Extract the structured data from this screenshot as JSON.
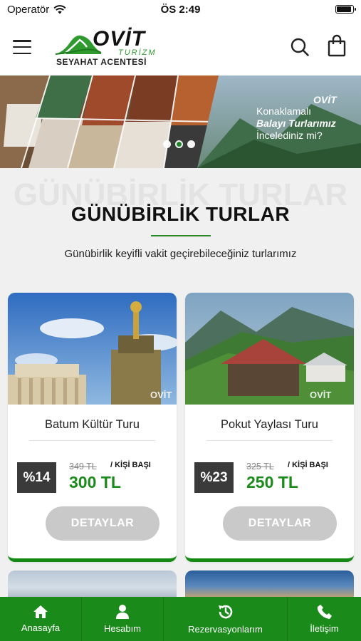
{
  "status_bar": {
    "carrier": "Operatör",
    "time": "ÖS 2:49",
    "battery_level": 0.9
  },
  "header": {
    "brand": "OVİT",
    "brand_sub": "TURİZM",
    "agency": "SEYAHAT ACENTESİ"
  },
  "banner": {
    "line1": "Konaklamalı",
    "line2": "Balayı Turlarımız",
    "line3": "İncelediniz mi?",
    "logo": "OVİT",
    "active_slide": 2,
    "slide_count": 3
  },
  "section": {
    "watermark": "GÜNÜBİRLİK TURLAR",
    "title": "GÜNÜBİRLİK TURLAR",
    "subtitle": "Günübirlik keyifli vakit geçirebileceğiniz turlarımız"
  },
  "tours": [
    {
      "title": "Batum Kültür Turu",
      "discount": "%14",
      "old_price": "349 TL",
      "per_person": "/ KİŞİ BAŞI",
      "price": "300 TL",
      "button": "DETAYLAR",
      "image_watermark": "OVİT"
    },
    {
      "title": "Pokut Yaylası Turu",
      "discount": "%23",
      "old_price": "325 TL",
      "per_person": "/ KİŞİ BAŞI",
      "price": "250 TL",
      "button": "DETAYLAR",
      "image_watermark": "OVİT"
    }
  ],
  "bottom_nav": [
    {
      "label": "Anasayfa",
      "icon": "home-icon"
    },
    {
      "label": "Hesabım",
      "icon": "user-icon"
    },
    {
      "label": "Rezervasyonlarım",
      "icon": "history-icon"
    },
    {
      "label": "İletişim",
      "icon": "phone-icon"
    }
  ],
  "colors": {
    "brand_green": "#1a8a1a",
    "button_gray": "#c9c9c9",
    "discount_bg": "#3a3a3a"
  }
}
